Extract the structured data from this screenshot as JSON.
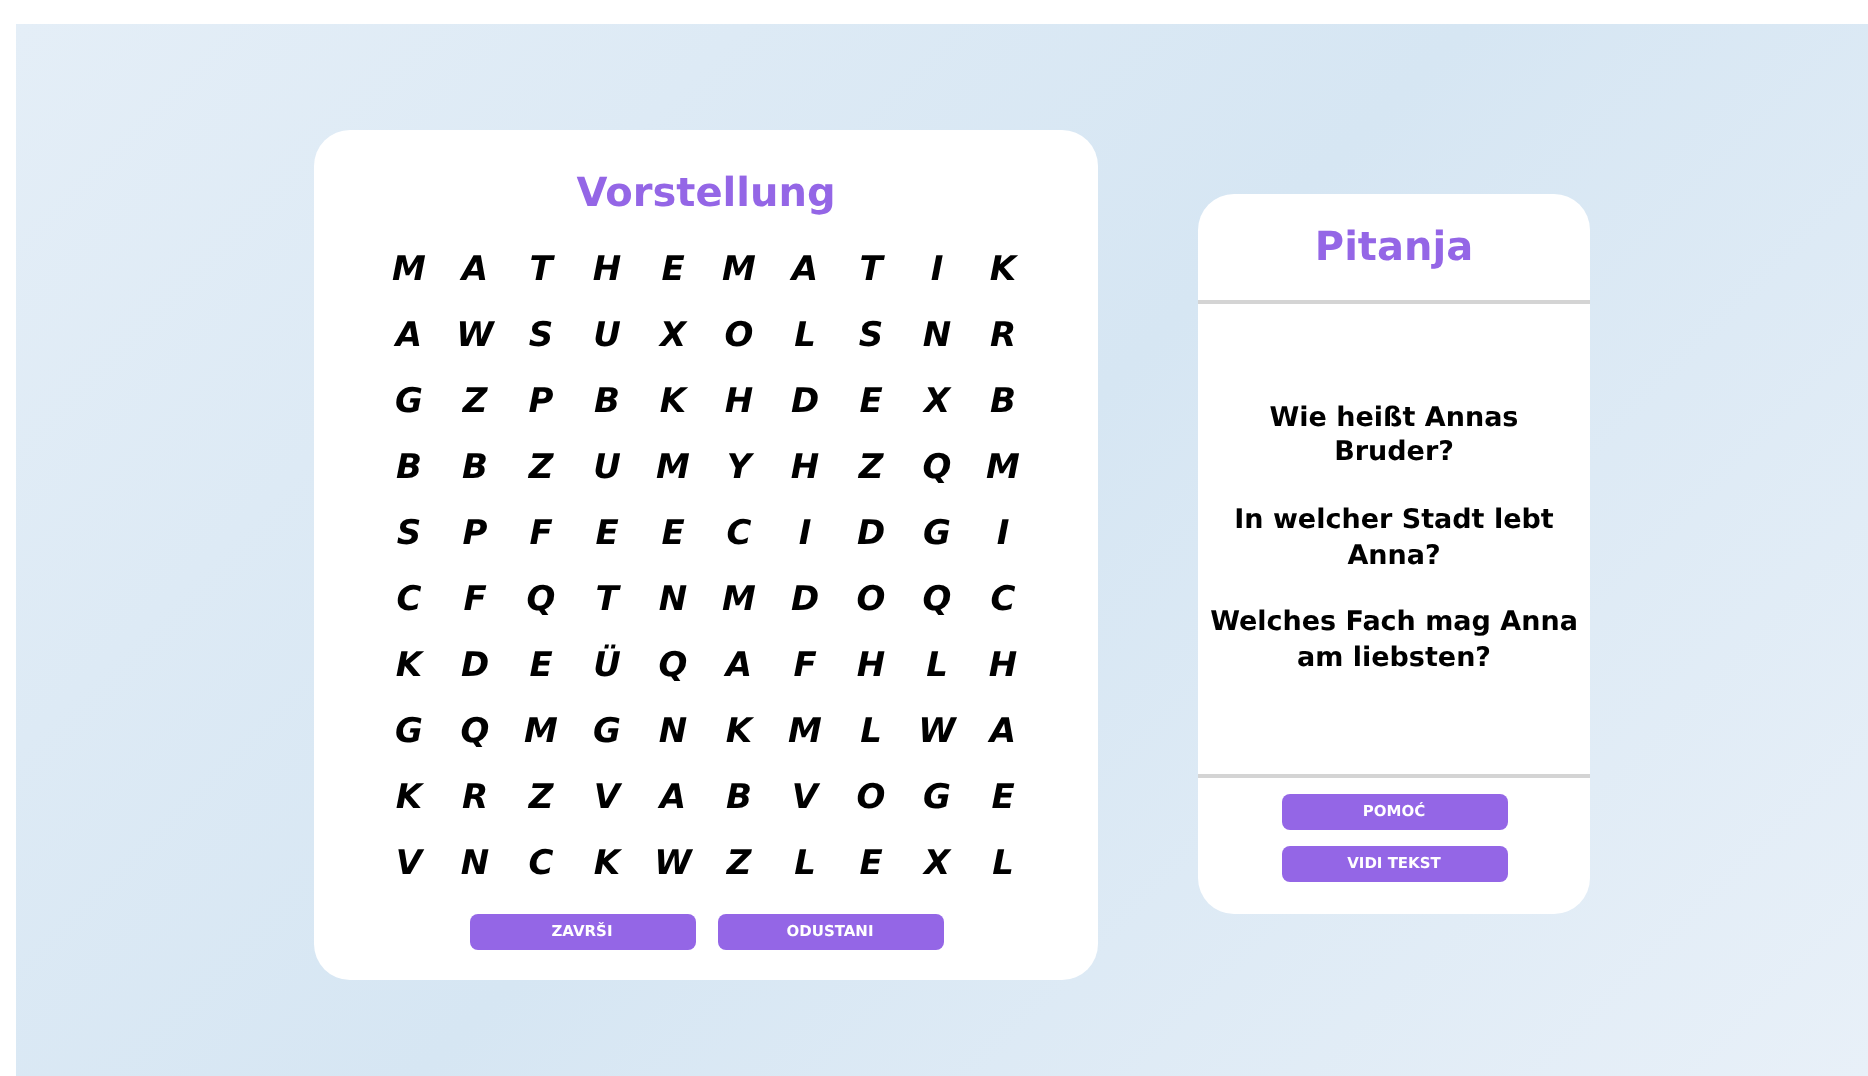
{
  "puzzle": {
    "title": "Vorstellung",
    "grid": [
      [
        "M",
        "A",
        "T",
        "H",
        "E",
        "M",
        "A",
        "T",
        "I",
        "K"
      ],
      [
        "A",
        "W",
        "S",
        "U",
        "X",
        "O",
        "L",
        "S",
        "N",
        "R"
      ],
      [
        "G",
        "Z",
        "P",
        "B",
        "K",
        "H",
        "D",
        "E",
        "X",
        "B"
      ],
      [
        "B",
        "B",
        "Z",
        "U",
        "M",
        "Y",
        "H",
        "Z",
        "Q",
        "M"
      ],
      [
        "S",
        "P",
        "F",
        "E",
        "E",
        "C",
        "I",
        "D",
        "G",
        "I"
      ],
      [
        "C",
        "F",
        "Q",
        "T",
        "N",
        "M",
        "D",
        "O",
        "Q",
        "C"
      ],
      [
        "K",
        "D",
        "E",
        "Ü",
        "Q",
        "A",
        "F",
        "H",
        "L",
        "H"
      ],
      [
        "G",
        "Q",
        "M",
        "G",
        "N",
        "K",
        "M",
        "L",
        "W",
        "A"
      ],
      [
        "K",
        "R",
        "Z",
        "V",
        "A",
        "B",
        "V",
        "O",
        "G",
        "E"
      ],
      [
        "V",
        "N",
        "C",
        "K",
        "W",
        "Z",
        "L",
        "E",
        "X",
        "L"
      ]
    ],
    "buttons": [
      "ZAVRŠI",
      "ODUSTANI"
    ]
  },
  "questions_panel": {
    "title": "Pitanja",
    "questions": [
      "Wie heißt Annas Bruder?",
      "In welcher Stadt lebt Anna?",
      "Welches Fach mag Anna am liebsten?"
    ],
    "buttons": [
      "POMOĆ",
      "VIDI TEKST"
    ]
  }
}
